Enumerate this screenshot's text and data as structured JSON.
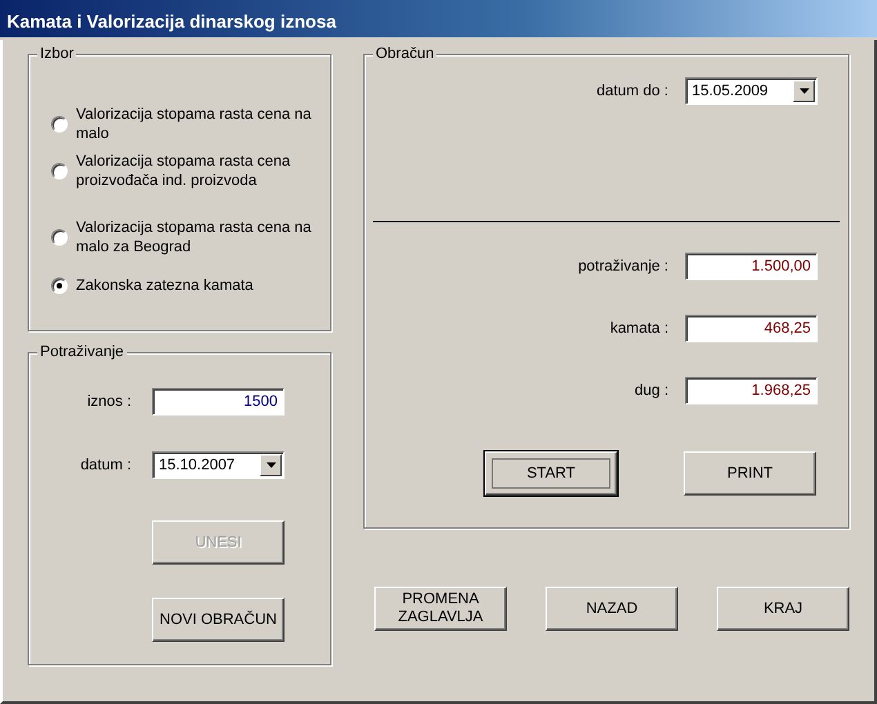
{
  "window": {
    "title": "Kamata i Valorizacija dinarskog iznosa"
  },
  "izbor": {
    "title": "Izbor",
    "options": [
      {
        "label": "Valorizacija stopama rasta cena na malo",
        "selected": false
      },
      {
        "label": "Valorizacija stopama rasta cena proizvođača ind. proizvoda",
        "selected": false
      },
      {
        "label": "Valorizacija stopama rasta cena na malo za Beograd",
        "selected": false
      },
      {
        "label": "Zakonska zatezna kamata",
        "selected": true
      }
    ]
  },
  "potrazivanje": {
    "title": "Potraživanje",
    "iznos": {
      "label": "iznos :",
      "value": "1500"
    },
    "datum": {
      "label": "datum :",
      "value": "15.10.2007"
    },
    "buttons": [
      {
        "label": "UNESI",
        "disabled": true
      },
      {
        "label": "NOVI OBRAČUN",
        "disabled": false
      }
    ]
  },
  "obracun": {
    "title": "Obračun",
    "datum_do": {
      "label": "datum do :",
      "value": "15.05.2009"
    },
    "results": [
      {
        "label": "potraživanje :",
        "value": "1.500,00"
      },
      {
        "label": "kamata :",
        "value": "468,25"
      },
      {
        "label": "dug :",
        "value": "1.968,25"
      }
    ],
    "buttons": [
      {
        "label": "START",
        "focused": true
      },
      {
        "label": "PRINT",
        "focused": false
      }
    ]
  },
  "bottom_buttons": [
    {
      "label": "PROMENA ZAGLAVLJA"
    },
    {
      "label": "NAZAD"
    },
    {
      "label": "KRAJ"
    }
  ]
}
